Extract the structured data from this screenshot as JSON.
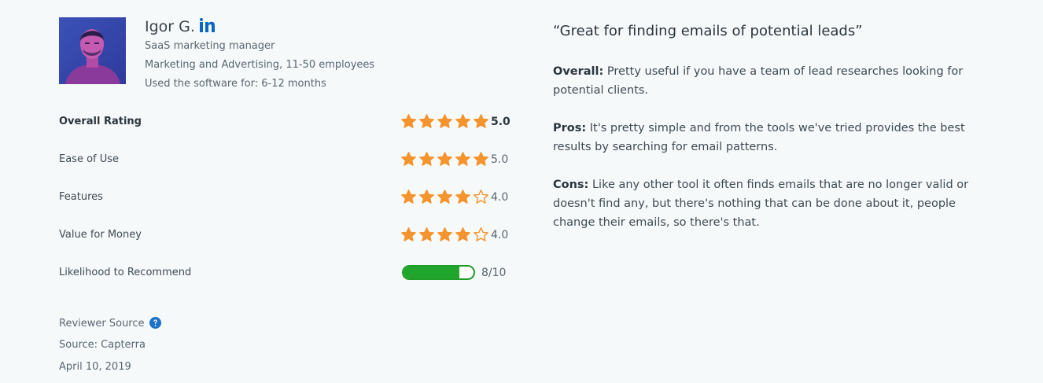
{
  "reviewer": {
    "name": "Igor G.",
    "title": "SaaS marketing manager",
    "company": "Marketing and Advertising, 11-50 employees",
    "usage": "Used the software for: 6-12 months",
    "avatar_icon": "reviewer-photo",
    "social_icon": "linkedin-icon"
  },
  "ratings": [
    {
      "label": "Overall Rating",
      "score": 5,
      "max": 5,
      "value_text": "5.0"
    },
    {
      "label": "Ease of Use",
      "score": 5,
      "max": 5,
      "value_text": "5.0"
    },
    {
      "label": "Features",
      "score": 4,
      "max": 5,
      "value_text": "4.0"
    },
    {
      "label": "Value for Money",
      "score": 4,
      "max": 5,
      "value_text": "4.0"
    }
  ],
  "recommend": {
    "label": "Likelihood to Recommend",
    "score": 8,
    "max": 10,
    "value_text": "8/10"
  },
  "source": {
    "reviewer_source_label": "Reviewer Source",
    "help_icon": "question-circle-icon",
    "source_text": "Source: Capterra",
    "date": "April 10, 2019"
  },
  "review": {
    "title": "“Great for finding emails of potential leads”",
    "overall_label": "Overall:",
    "overall_text": "Pretty useful if you have a team of lead researches looking for potential clients.",
    "pros_label": "Pros:",
    "pros_text": "It's pretty simple and from the tools we've tried provides the best results by searching for email patterns.",
    "cons_label": "Cons:",
    "cons_text": "Like any other tool it often finds emails that are no longer valid or doesn't find any, but there's nothing that can be done about it, people change their emails, so there's that."
  },
  "colors": {
    "star": "#f5932c",
    "bar_fill": "#22a52c",
    "linkedin": "#0a66c2",
    "help": "#1b73c9",
    "background": "#f6f9fa"
  }
}
